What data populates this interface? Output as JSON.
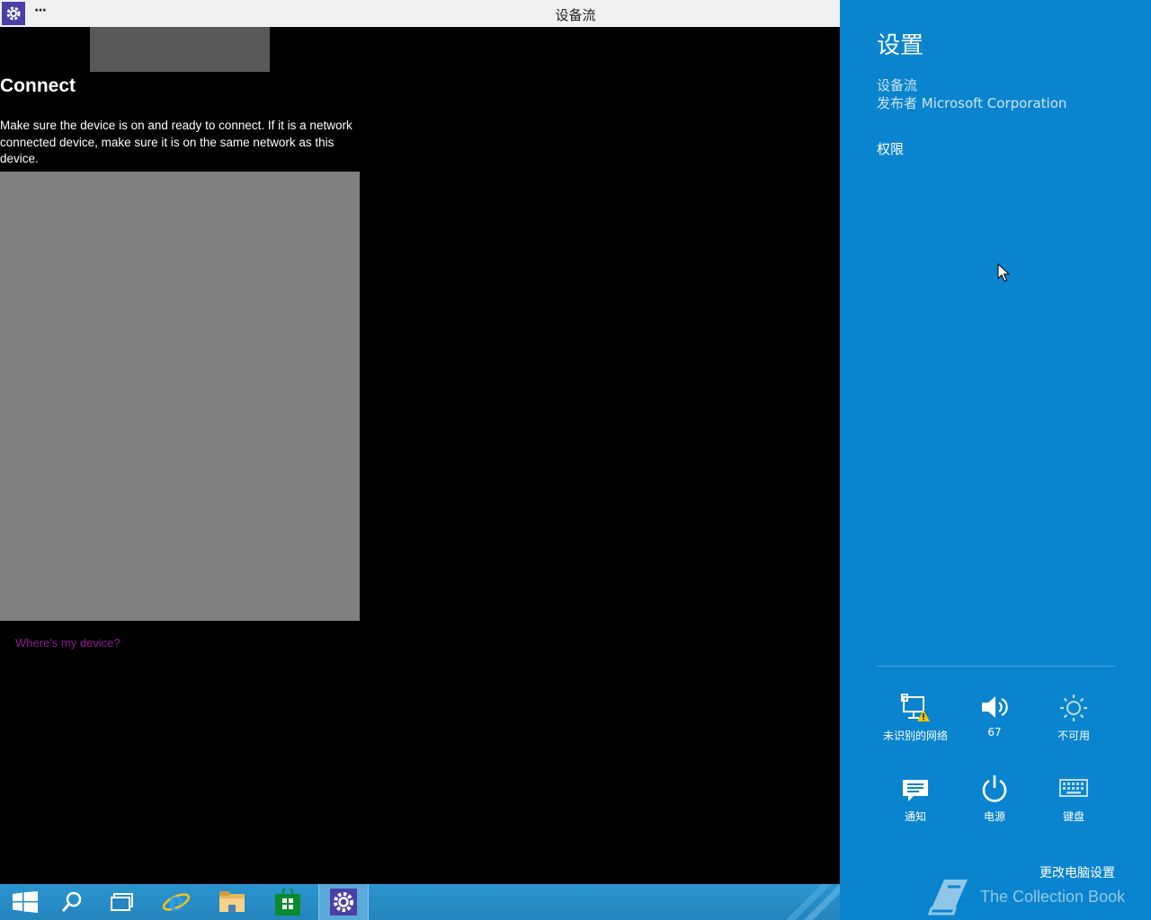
{
  "window": {
    "title": "设备流",
    "menu_label": "···"
  },
  "main": {
    "heading": "Connect",
    "description": "Make sure the device is on and ready to connect. If it is a network connected device, make sure it is on the same network as this device.",
    "link": "Where's my device?"
  },
  "taskbar": {
    "items": [
      "start-icon",
      "search-icon",
      "task-view-icon",
      "internet-explorer-icon",
      "file-explorer-icon",
      "store-icon",
      "settings-icon"
    ],
    "active": "settings-icon"
  },
  "charm": {
    "title": "设置",
    "app_name": "设备流",
    "publisher": "发布者 Microsoft Corporation",
    "permissions": "权限",
    "quick_settings": [
      {
        "label": "未识别的网络",
        "icon": "network-warning-icon"
      },
      {
        "label": "67",
        "icon": "volume-icon"
      },
      {
        "label": "不可用",
        "icon": "brightness-icon"
      },
      {
        "label": "通知",
        "icon": "notifications-icon"
      },
      {
        "label": "电源",
        "icon": "power-icon"
      },
      {
        "label": "键盘",
        "icon": "keyboard-icon"
      }
    ],
    "change_pc_settings": "更改电脑设置",
    "watermark": "The Collection Book"
  },
  "colors": {
    "charm_bg": "#0a84ce",
    "link": "#8e1b97",
    "app_icon_bg": "#4b3fa8"
  }
}
